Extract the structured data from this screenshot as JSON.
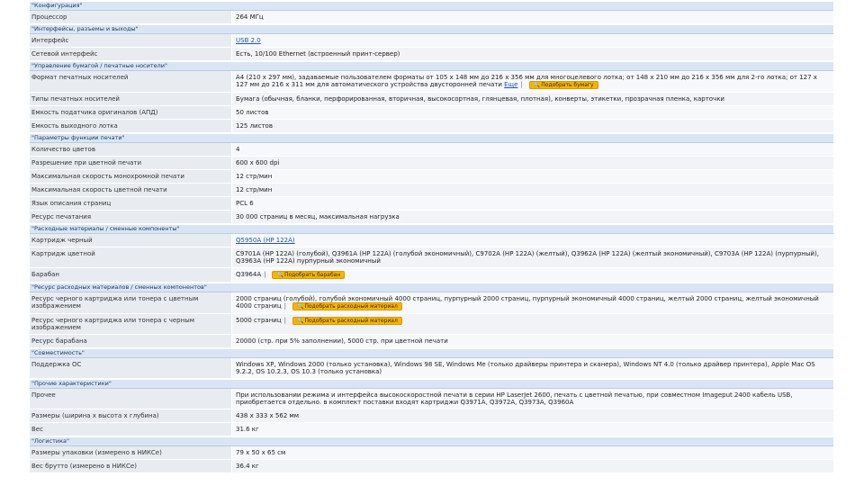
{
  "sections": [
    {
      "title": "\"Конфигурация\"",
      "rows": [
        {
          "label": "Процессор",
          "value": "264 МГц"
        }
      ]
    },
    {
      "title": "\"Интерфейсы, разъемы и выходы\"",
      "rows": [
        {
          "label": "Интерфейс",
          "link": "USB 2.0"
        },
        {
          "label": "Сетевой интерфейс",
          "value": "Есть, 10/100 Ethernet (встроенный принт-сервер)"
        }
      ]
    },
    {
      "title": "\"Управление бумагой / печатные носители\"",
      "rows": [
        {
          "label": "Формат печатных носителей",
          "value": "A4 (210 x 297 мм), задаваемые пользователем форматы от 105 x 148 мм до 216 x 356 мм для многоцелевого лотка; от 148 x 210 мм до 216 x 356 мм для 2-го лотка; от 127 x 127 мм до 216 x 311 мм для автоматического устройства двусторонней печати",
          "link": "Еще",
          "button": "Подобрать бумагу"
        },
        {
          "label": "Типы печатных носителей",
          "value": "Бумага (обычная, бланки, перфорированная, вторичная, высокосортная, глянцевая, плотная), конверты, этикетки, прозрачная пленка, карточки"
        },
        {
          "label": "Емкость податчика оригиналов (АПД)",
          "value": "50 листов"
        },
        {
          "label": "Емкость выходного лотка",
          "value": "125 листов"
        }
      ]
    },
    {
      "title": "\"Параметры функции печати\"",
      "rows": [
        {
          "label": "Количество цветов",
          "value": "4"
        },
        {
          "label": "Разрешение при цветной печати",
          "value": "600 x 600 dpi"
        },
        {
          "label": "Максимальная скорость монохромной печати",
          "value": "12 стр/мин"
        },
        {
          "label": "Максимальная скорость цветной печати",
          "value": "12 стр/мин"
        },
        {
          "label": "Язык описания страниц",
          "value": "PCL 6"
        },
        {
          "label": "Ресурс печатания",
          "value": "30 000 страниц в месяц, максимальная нагрузка"
        }
      ]
    },
    {
      "title": "\"Расходные материалы / сменные компоненты\"",
      "rows": [
        {
          "label": "Картридж черный",
          "link": "Q5950A (HP 122A)"
        },
        {
          "label": "Картридж цветной",
          "value": "C9701A (HP 122A) (голубой), Q3961A (HP 122A) (голубой экономичный), C9702A (HP 122A) (желтый), Q3962A (HP 122A) (желтый экономичный), C9703A (HP 122A) (пурпурный), Q3963A (HP 122A) пурпурный экономичный"
        },
        {
          "label": "Барабан",
          "value": "Q3964A",
          "button": "Подобрать барабан"
        }
      ]
    },
    {
      "title": "\"Ресурс расходных материалов / сменных компонентов\"",
      "rows": [
        {
          "label": "Ресурс черного картриджа или тонера с цветным изображением",
          "value": "2000 страниц (голубой), голубой экономичный 4000 страниц, пурпурный 2000 страниц, пурпурный экономичный 4000 страниц, желтый 2000 страниц, желтый экономичный 4000 страниц",
          "button": "Подобрать расходный материал"
        },
        {
          "label": "Ресурс черного картриджа или тонера с черным изображением",
          "value": "5000 страниц",
          "button": "Подобрать расходный материал"
        },
        {
          "label": "Ресурс барабана",
          "value": "20000 (стр. при 5% заполнении), 5000 стр. при цветной печати"
        }
      ]
    },
    {
      "title": "\"Совместимость\"",
      "rows": [
        {
          "label": "Поддержка ОС",
          "value": "Windows XP, Windows 2000 (только установка), Windows 98 SE, Windows Me (только драйверы принтера и сканера), Windows NT 4.0 (только драйвер принтера), Apple Mac OS 9.2.2, OS 10.2.3, OS 10.3 (только установка)"
        }
      ]
    },
    {
      "title": "\"Прочие характеристики\"",
      "rows": [
        {
          "label": "Прочее",
          "value": "При использовании режима и интерфейса высокоскоростной печати в серии HP LaserJet 2600, печать с цветной печатью, при совместном Imageput 2400 кабель USB, приобретается отдельно. в комплект поставки входят картриджи Q3971A, Q3972A, Q3973A, Q3960A"
        },
        {
          "label": "Размеры (ширина x высота x глубина)",
          "value": "438 x 333 x 562 мм"
        },
        {
          "label": "Вес",
          "value": "31.6 кг"
        }
      ]
    },
    {
      "title": "\"Логистика\"",
      "rows": [
        {
          "label": "Размеры упаковки (измерено в НИКСе)",
          "value": "79 x 50 x 65 см"
        },
        {
          "label": "Вес брутто (измерено в НИКСе)",
          "value": "36.4 кг"
        }
      ]
    }
  ]
}
